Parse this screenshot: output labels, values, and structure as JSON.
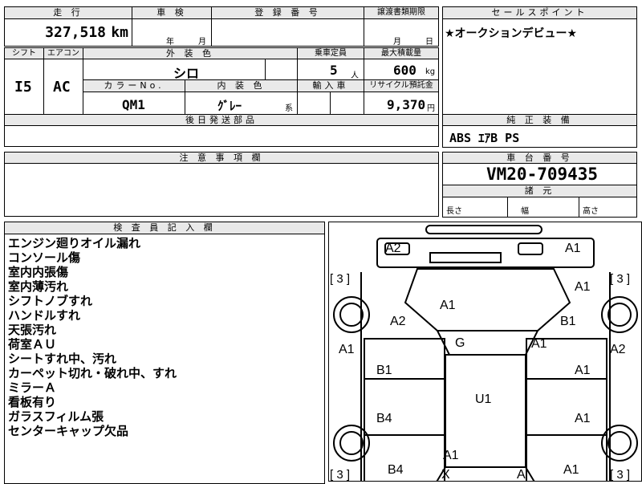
{
  "header": {
    "mileage_label": "走 行",
    "mileage_value": "327,518",
    "mileage_unit": "km",
    "inspection_label": "車 検",
    "insp_year": "年",
    "insp_month": "月",
    "reg_label": "登 録 番 号",
    "transfer_label": "譲渡書類期限",
    "transfer_month": "月",
    "transfer_day": "日"
  },
  "sales_points": {
    "label": "セールスポイント",
    "text": "★オークションデビュー★"
  },
  "spec": {
    "shift_label": "シフト",
    "aircon_label": "エアコン",
    "exterior_label": "外 装 色",
    "seating_label": "乗車定員",
    "loadcap_label": "最大積載量",
    "shift_value": "I5",
    "aircon_value": "AC",
    "exterior_value": "シロ",
    "seating_value": "5",
    "seating_unit": "人",
    "loadcap_value": "600",
    "loadcap_unit": "kg",
    "color_no_label": "カラーNo.",
    "interior_label": "内 装 色",
    "import_label": "輸入車",
    "recycle_label": "リサイクル預託金",
    "color_no_value": "QM1",
    "interior_value": "ｸﾞﾚｰ",
    "interior_suffix": "系",
    "recycle_value": "9,370",
    "recycle_unit": "円",
    "later_parts_label": "後日発送部品"
  },
  "genuine": {
    "label": "純 正 装 備",
    "value": "ABS ｴｱB PS"
  },
  "caution": {
    "label": "注 意 事 項 欄"
  },
  "chassis": {
    "label": "車 台 番 号",
    "value": "VM20-709435",
    "dims_label": "諸 元",
    "length_label": "長さ",
    "width_label": "幅",
    "height_label": "高さ"
  },
  "inspector": {
    "label": "検 査 員 記 入 欄",
    "notes": [
      "エンジン廻りオイル漏れ",
      "コンソール傷",
      "室内内張傷",
      "室内薄汚れ",
      "シフトノブすれ",
      "ハンドルすれ",
      "天張汚れ",
      "荷室ＡＵ",
      "シートすれ中、汚れ",
      "カーペット切れ・破れ中、すれ",
      "ミラーＡ",
      "看板有り",
      "ガラスフィルム張",
      "センターキャップ欠品"
    ]
  },
  "diagram": {
    "tire_marks": [
      "[ 3 ]",
      "[ 3 ]",
      "[ 3 ]",
      "[ 3 ]"
    ],
    "damage": [
      "A2",
      "A1",
      "A1",
      "A1",
      "A2",
      "B1",
      "A1",
      "A2",
      "G",
      "A1",
      "B1",
      "A1",
      "U1",
      "B4",
      "A1",
      "A1",
      "B4",
      "A1",
      "X",
      "A"
    ]
  }
}
